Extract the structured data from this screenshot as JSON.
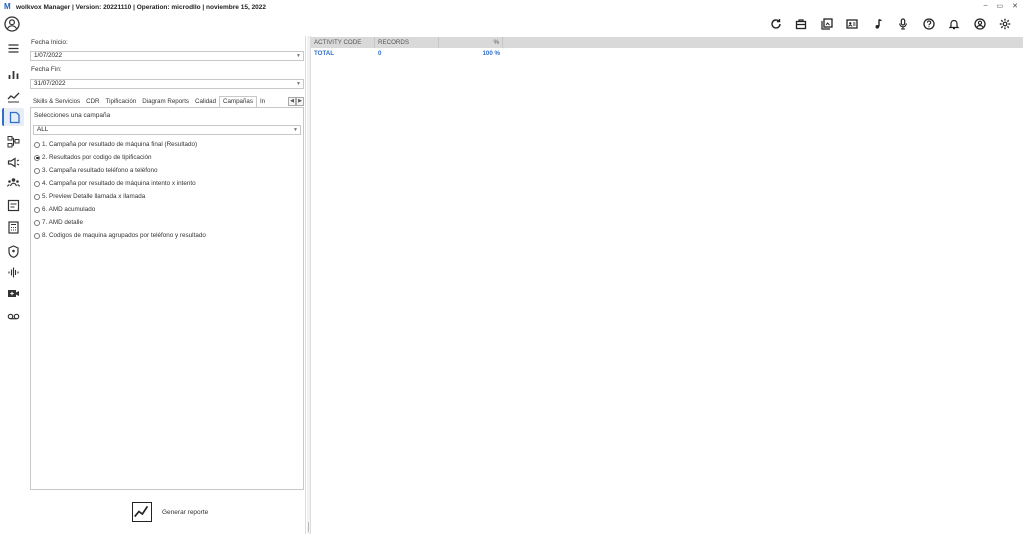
{
  "window": {
    "title": "wolkvox Manager  | Version: 20221110 |  Operation: microdllo | noviembre 15, 2022",
    "controls": [
      "–",
      "▭",
      "✕"
    ]
  },
  "toolbar": {
    "icons": [
      "refresh-icon",
      "briefcase-icon",
      "gallery-icon",
      "contact-card-icon",
      "music-note-icon",
      "microphone-icon",
      "help-icon",
      "bell-icon",
      "user-circle-icon",
      "settings-icon"
    ]
  },
  "nav": {
    "items": [
      "menu-icon",
      "bar-chart-icon",
      "trend-icon",
      "report-icon",
      "flow-icon",
      "broadcast-icon",
      "team-icon",
      "checklist-icon",
      "calculator-icon",
      "shield-icon",
      "audio-wave-icon",
      "video-call-icon",
      "voicemail-icon"
    ],
    "active_index": 3
  },
  "form": {
    "fecha_inicio_label": "Fecha Inicio:",
    "fecha_inicio_value": "1/07/2022",
    "fecha_fin_label": "Fecha Fin:",
    "fecha_fin_value": "31/07/2022",
    "tabs": [
      "Skills & Servicios",
      "CDR",
      "Tipificación",
      "Diagram Reports",
      "Calidad",
      "Campañas",
      "In"
    ],
    "active_tab": "Campañas",
    "campaign_label": "Selecciones una campaña",
    "campaign_value": "ALL",
    "options": [
      "1. Campaña por resultado de máquina final (Resultado)",
      "2. Resultados por codigo de tipificación",
      "3. Campaña resultado teléfono a teléfono",
      "4. Campaña por resultado de máquina intento x intento",
      "5. Preview Detalle llamada x llamada",
      "6. AMD acumulado",
      "7. AMD detalle",
      "8. Codigos de maquina agrupados por teléfono y resultado"
    ],
    "selected_option": 1,
    "generate_label": "Generar reporte"
  },
  "grid": {
    "columns": [
      "ACTIVITY CODE",
      "RECORDS",
      "%"
    ],
    "rows": [
      {
        "activity_code": "TOTAL",
        "records": "0",
        "percent": "100 %"
      }
    ]
  }
}
